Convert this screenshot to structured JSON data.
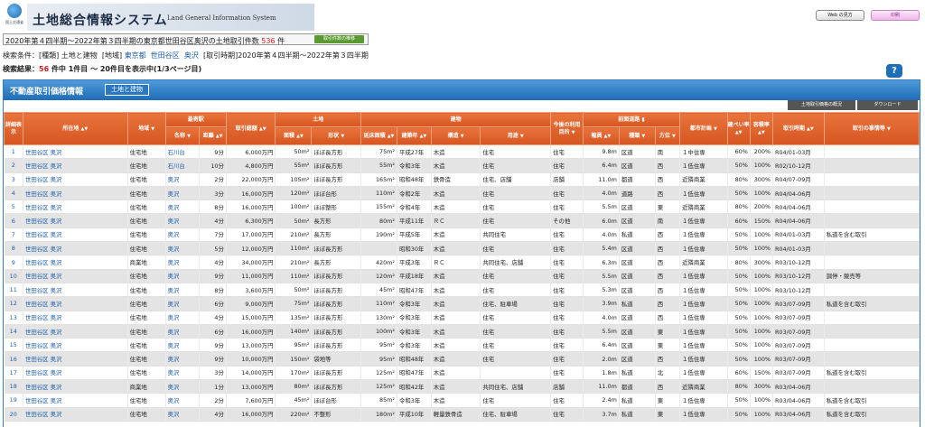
{
  "header": {
    "agency_caption": "国土交通省",
    "title_jp": "土地総合情報システム",
    "title_en": "Land General Information System",
    "how_to_label": "Web の見方",
    "print_label": "印刷",
    "colors": {
      "accent": "#1f6db7",
      "header_orange": "#d55521",
      "link": "#1e5fae",
      "count_red": "#d01c1c"
    }
  },
  "count_bar": {
    "prefix": "2020年第４四半期〜2022年第３四半期の東京都世田谷区奥沢の土地取引件数",
    "count": "536",
    "suffix": "件",
    "trend_button": "取引件数の推移"
  },
  "conditions": {
    "label": "検索条件：",
    "kind_label": "[種類]",
    "kind": "土地と建物",
    "area_label": "[地域]",
    "area_pref": "東京都",
    "area_city": "世田谷区",
    "area_town": "奥沢",
    "period_label": "[取引時期]",
    "period": "2020年第４四半期〜2022年第３四半期"
  },
  "results": {
    "label": "検索結果：",
    "total": "56",
    "middle": "件中 1件目 〜 20件目を表示中(1/3ページ目)"
  },
  "help_icon_glyph": "?",
  "panel": {
    "title": "不動産取引価格情報",
    "type_badge": "土地と建物",
    "overview_button": "土地取引価格の概況",
    "download_button": "ダウンロード"
  },
  "table": {
    "headers": {
      "detail": "詳細表示",
      "location": "所在地",
      "district": "地域",
      "station_group": "最寄駅",
      "station_name": "名称",
      "station_dist": "距離",
      "total_price": "取引総額",
      "land_group": "土地",
      "land_area": "面積",
      "land_shape": "形状",
      "building_group": "建物",
      "floor_area": "延床面積",
      "built_year": "建築年",
      "structure": "構造",
      "usage": "用途",
      "future_use": "今後の利用目的",
      "road_group": "前面道路",
      "road_width": "幅員",
      "road_type": "種類",
      "road_dir": "方位",
      "city_plan": "都市計画",
      "bcr": "建ぺい率",
      "far": "容積率",
      "period": "取引時期",
      "circumstances": "取引の事情等"
    },
    "rows": [
      {
        "no": "1",
        "city": "世田谷区",
        "town": "奥沢",
        "district": "住宅地",
        "station": "石川台",
        "dist": "9分",
        "price": "6,000万円",
        "area": "50m²",
        "shape": "ほぼ長方形",
        "floor": "75m²",
        "year": "平成27年",
        "structure": "木造",
        "usage": "住宅",
        "future": "住宅",
        "width": "9.8m",
        "rtype": "区道",
        "dir": "南",
        "plan": "１中住専",
        "bcr": "60%",
        "far": "200%",
        "period": "R04/01-03月",
        "note": ""
      },
      {
        "no": "2",
        "city": "世田谷区",
        "town": "奥沢",
        "district": "住宅地",
        "station": "石川台",
        "dist": "10分",
        "price": "4,800万円",
        "area": "55m²",
        "shape": "ほぼ長方形",
        "floor": "55m²",
        "year": "令和3年",
        "structure": "木造",
        "usage": "住宅",
        "future": "住宅",
        "width": "6.4m",
        "rtype": "区道",
        "dir": "西",
        "plan": "１低住専",
        "bcr": "50%",
        "far": "100%",
        "period": "R02/10-12月",
        "note": ""
      },
      {
        "no": "3",
        "city": "世田谷区",
        "town": "奥沢",
        "district": "住宅地",
        "station": "奥沢",
        "dist": "2分",
        "price": "22,000万円",
        "area": "105m²",
        "shape": "ほぼ長方形",
        "floor": "165m²",
        "year": "昭和48年",
        "structure": "鉄骨造",
        "usage": "住宅、店舗",
        "future": "店舗",
        "width": "11.0m",
        "rtype": "都道",
        "dir": "西",
        "plan": "近隣商業",
        "bcr": "80%",
        "far": "300%",
        "period": "R04/07-09月",
        "note": ""
      },
      {
        "no": "4",
        "city": "世田谷区",
        "town": "奥沢",
        "district": "住宅地",
        "station": "奥沢",
        "dist": "3分",
        "price": "16,000万円",
        "area": "120m²",
        "shape": "ほぼ台形",
        "floor": "110m²",
        "year": "令和2年",
        "structure": "木造",
        "usage": "住宅",
        "future": "住宅",
        "width": "4.0m",
        "rtype": "道路",
        "dir": "西",
        "plan": "１低住専",
        "bcr": "50%",
        "far": "100%",
        "period": "R04/04-06月",
        "note": ""
      },
      {
        "no": "5",
        "city": "世田谷区",
        "town": "奥沢",
        "district": "住宅地",
        "station": "奥沢",
        "dist": "8分",
        "price": "16,000万円",
        "area": "100m²",
        "shape": "ほぼ整形",
        "floor": "155m²",
        "year": "令和4年",
        "structure": "木造",
        "usage": "住宅",
        "future": "住宅",
        "width": "5.5m",
        "rtype": "区道",
        "dir": "東",
        "plan": "近隣商業",
        "bcr": "80%",
        "far": "200%",
        "period": "R04/04-06月",
        "note": ""
      },
      {
        "no": "6",
        "city": "世田谷区",
        "town": "奥沢",
        "district": "住宅地",
        "station": "奥沢",
        "dist": "4分",
        "price": "6,300万円",
        "area": "50m²",
        "shape": "長方形",
        "floor": "80m²",
        "year": "平成11年",
        "structure": "ＲＣ",
        "usage": "住宅",
        "future": "その他",
        "width": "6.0m",
        "rtype": "区道",
        "dir": "南",
        "plan": "１低住専",
        "bcr": "60%",
        "far": "150%",
        "period": "R04/04-06月",
        "note": ""
      },
      {
        "no": "7",
        "city": "世田谷区",
        "town": "奥沢",
        "district": "住宅地",
        "station": "奥沢",
        "dist": "7分",
        "price": "17,000万円",
        "area": "210m²",
        "shape": "長方形",
        "floor": "190m²",
        "year": "平成5年",
        "structure": "木造",
        "usage": "共同住宅",
        "future": "住宅",
        "width": "4.0m",
        "rtype": "私道",
        "dir": "西",
        "plan": "１低住専",
        "bcr": "50%",
        "far": "100%",
        "period": "R04/01-03月",
        "note": "私道を含む取引"
      },
      {
        "no": "8",
        "city": "世田谷区",
        "town": "奥沢",
        "district": "住宅地",
        "station": "奥沢",
        "dist": "5分",
        "price": "12,000万円",
        "area": "110m²",
        "shape": "ほぼ長方形",
        "floor": "",
        "year": "昭和30年",
        "structure": "木造",
        "usage": "住宅",
        "future": "住宅",
        "width": "5.4m",
        "rtype": "区道",
        "dir": "西",
        "plan": "１低住専",
        "bcr": "50%",
        "far": "100%",
        "period": "R04/01-03月",
        "note": ""
      },
      {
        "no": "9",
        "city": "世田谷区",
        "town": "奥沢",
        "district": "商業地",
        "station": "奥沢",
        "dist": "4分",
        "price": "34,000万円",
        "area": "210m²",
        "shape": "長方形",
        "floor": "420m²",
        "year": "平成3年",
        "structure": "ＲＣ",
        "usage": "共同住宅、店舗",
        "future": "住宅",
        "width": "6.3m",
        "rtype": "区道",
        "dir": "西",
        "plan": "近隣商業",
        "bcr": "80%",
        "far": "300%",
        "period": "R03/10-12月",
        "note": ""
      },
      {
        "no": "10",
        "city": "世田谷区",
        "town": "奥沢",
        "district": "住宅地",
        "station": "奥沢",
        "dist": "9分",
        "price": "11,000万円",
        "area": "110m²",
        "shape": "ほぼ長方形",
        "floor": "120m²",
        "year": "平成18年",
        "structure": "木造",
        "usage": "住宅",
        "future": "住宅",
        "width": "5.5m",
        "rtype": "区道",
        "dir": "西",
        "plan": "１低住専",
        "bcr": "50%",
        "far": "100%",
        "period": "R03/10-12月",
        "note": "調停・競売等"
      },
      {
        "no": "11",
        "city": "世田谷区",
        "town": "奥沢",
        "district": "住宅地",
        "station": "奥沢",
        "dist": "8分",
        "price": "3,600万円",
        "area": "50m²",
        "shape": "ほぼ長方形",
        "floor": "45m²",
        "year": "昭和47年",
        "structure": "木造",
        "usage": "住宅",
        "future": "住宅",
        "width": "5.3m",
        "rtype": "区道",
        "dir": "西",
        "plan": "１低住専",
        "bcr": "50%",
        "far": "100%",
        "period": "R03/10-12月",
        "note": ""
      },
      {
        "no": "12",
        "city": "世田谷区",
        "town": "奥沢",
        "district": "住宅地",
        "station": "奥沢",
        "dist": "6分",
        "price": "9,000万円",
        "area": "75m²",
        "shape": "ほぼ長方形",
        "floor": "110m²",
        "year": "令和3年",
        "structure": "木造",
        "usage": "住宅、駐車場",
        "future": "住宅",
        "width": "3.9m",
        "rtype": "私道",
        "dir": "西",
        "plan": "１低住専",
        "bcr": "50%",
        "far": "100%",
        "period": "R03/07-09月",
        "note": "私道を含む取引"
      },
      {
        "no": "13",
        "city": "世田谷区",
        "town": "奥沢",
        "district": "住宅地",
        "station": "奥沢",
        "dist": "4分",
        "price": "15,000万円",
        "area": "135m²",
        "shape": "ほぼ長方形",
        "floor": "130m²",
        "year": "令和3年",
        "structure": "木造",
        "usage": "住宅",
        "future": "住宅",
        "width": "4.0m",
        "rtype": "区道",
        "dir": "西",
        "plan": "１低住専",
        "bcr": "50%",
        "far": "100%",
        "period": "R03/07-09月",
        "note": ""
      },
      {
        "no": "14",
        "city": "世田谷区",
        "town": "奥沢",
        "district": "住宅地",
        "station": "奥沢",
        "dist": "6分",
        "price": "16,000万円",
        "area": "140m²",
        "shape": "ほぼ長方形",
        "floor": "100m²",
        "year": "令和3年",
        "structure": "木造",
        "usage": "住宅",
        "future": "住宅",
        "width": "5.5m",
        "rtype": "区道",
        "dir": "東",
        "plan": "１低住専",
        "bcr": "50%",
        "far": "100%",
        "period": "R03/07-09月",
        "note": ""
      },
      {
        "no": "15",
        "city": "世田谷区",
        "town": "奥沢",
        "district": "住宅地",
        "station": "奥沢",
        "dist": "9分",
        "price": "13,000万円",
        "area": "95m²",
        "shape": "ほぼ長方形",
        "floor": "95m²",
        "year": "令和3年",
        "structure": "木造",
        "usage": "住宅",
        "future": "住宅",
        "width": "6.4m",
        "rtype": "区道",
        "dir": "東",
        "plan": "１低住専",
        "bcr": "50%",
        "far": "100%",
        "period": "R03/07-09月",
        "note": ""
      },
      {
        "no": "16",
        "city": "世田谷区",
        "town": "奥沢",
        "district": "住宅地",
        "station": "奥沢",
        "dist": "9分",
        "price": "10,000万円",
        "area": "150m²",
        "shape": "袋地等",
        "floor": "95m²",
        "year": "昭和48年",
        "structure": "木造",
        "usage": "住宅",
        "future": "住宅",
        "width": "2.0m",
        "rtype": "区道",
        "dir": "西",
        "plan": "１低住専",
        "bcr": "50%",
        "far": "100%",
        "period": "R03/07-09月",
        "note": ""
      },
      {
        "no": "17",
        "city": "世田谷区",
        "town": "奥沢",
        "district": "住宅地",
        "station": "奥沢",
        "dist": "3分",
        "price": "14,000万円",
        "area": "170m²",
        "shape": "ほぼ長方形",
        "floor": "125m²",
        "year": "昭和47年",
        "structure": "木造",
        "usage": "",
        "future": "住宅",
        "width": "1.8m",
        "rtype": "私道",
        "dir": "北",
        "plan": "１低住専",
        "bcr": "60%",
        "far": "150%",
        "period": "R03/07-09月",
        "note": "私道を含む取引"
      },
      {
        "no": "18",
        "city": "世田谷区",
        "town": "奥沢",
        "district": "商業地",
        "station": "奥沢",
        "dist": "1分",
        "price": "13,000万円",
        "area": "80m²",
        "shape": "ほぼ長方形",
        "floor": "125m²",
        "year": "昭和42年",
        "structure": "木造",
        "usage": "共同住宅、店舗",
        "future": "店舗",
        "width": "11.0m",
        "rtype": "都道",
        "dir": "西",
        "plan": "近隣商業",
        "bcr": "80%",
        "far": "300%",
        "period": "R03/04-06月",
        "note": ""
      },
      {
        "no": "19",
        "city": "世田谷区",
        "town": "奥沢",
        "district": "住宅地",
        "station": "奥沢",
        "dist": "2分",
        "price": "7,600万円",
        "area": "45m²",
        "shape": "ほぼ台形",
        "floor": "85m²",
        "year": "令和3年",
        "structure": "木造",
        "usage": "住宅",
        "future": "住宅",
        "width": "2.4m",
        "rtype": "私道",
        "dir": "東",
        "plan": "１低住専",
        "bcr": "50%",
        "far": "100%",
        "period": "R03/04-06月",
        "note": "私道を含む取引"
      },
      {
        "no": "20",
        "city": "世田谷区",
        "town": "奥沢",
        "district": "住宅地",
        "station": "奥沢",
        "dist": "4分",
        "price": "16,000万円",
        "area": "220m²",
        "shape": "不整形",
        "floor": "180m²",
        "year": "平成10年",
        "structure": "軽量鉄骨造",
        "usage": "住宅、駐車場",
        "future": "住宅",
        "width": "3.7m",
        "rtype": "私道",
        "dir": "東",
        "plan": "１低住専",
        "bcr": "50%",
        "far": "100%",
        "period": "R03/04-06月",
        "note": "私道を含む取引"
      }
    ]
  }
}
